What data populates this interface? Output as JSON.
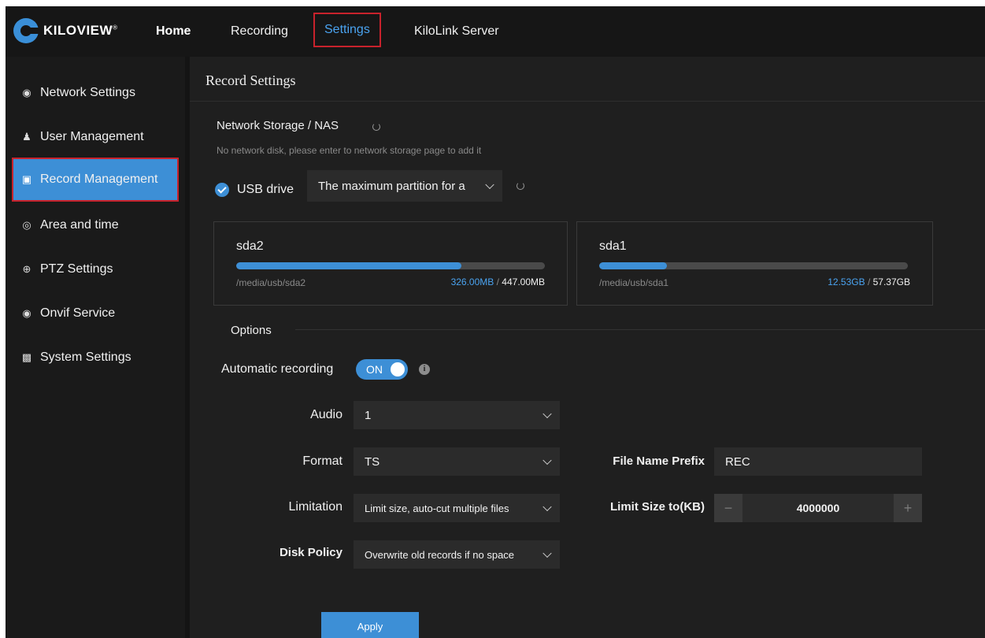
{
  "brand": {
    "name": "KILOVIEW",
    "reg": "®"
  },
  "topnav": [
    {
      "label": "Home"
    },
    {
      "label": "Recording"
    },
    {
      "label": "Settings"
    },
    {
      "label": "KiloLink Server"
    }
  ],
  "sidebar": {
    "items": [
      {
        "label": "Network Settings",
        "icon": "globe-icon"
      },
      {
        "label": "User Management",
        "icon": "users-icon"
      },
      {
        "label": "Record Management",
        "icon": "record-icon"
      },
      {
        "label": "Area and time",
        "icon": "clock-globe-icon"
      },
      {
        "label": "PTZ Settings",
        "icon": "ptz-icon"
      },
      {
        "label": "Onvif Service",
        "icon": "onvif-icon"
      },
      {
        "label": "System Settings",
        "icon": "system-icon"
      }
    ]
  },
  "page": {
    "title": "Record Settings"
  },
  "nas": {
    "label": "Network Storage / NAS",
    "message": "No network disk, please enter to network storage page to add it"
  },
  "usb": {
    "label": "USB drive",
    "partition_value": "The maximum partition for a"
  },
  "disks": [
    {
      "name": "sda2",
      "path": "/media/usb/sda2",
      "used": "326.00MB",
      "separator": "/",
      "total": "447.00MB",
      "fraction": 0.73
    },
    {
      "name": "sda1",
      "path": "/media/usb/sda1",
      "used": "12.53GB",
      "separator": "/",
      "total": "57.37GB",
      "fraction": 0.22
    }
  ],
  "options": {
    "heading": "Options",
    "auto_recording_label": "Automatic recording",
    "auto_recording_state": "ON",
    "audio_label": "Audio",
    "audio_value": "1",
    "format_label": "Format",
    "format_value": "TS",
    "prefix_label": "File Name Prefix",
    "prefix_value": "REC",
    "limitation_label": "Limitation",
    "limitation_value": "Limit size, auto-cut multiple files",
    "limit_size_label": "Limit Size to(KB)",
    "limit_size_value": "4000000",
    "minus": "−",
    "plus": "+",
    "disk_policy_label": "Disk Policy",
    "disk_policy_value": "Overwrite old records if no space",
    "apply_label": "Apply"
  },
  "colors": {
    "accent": "#3d8fd6",
    "highlight_border": "#c8222c",
    "background": "#1f1f1f"
  }
}
